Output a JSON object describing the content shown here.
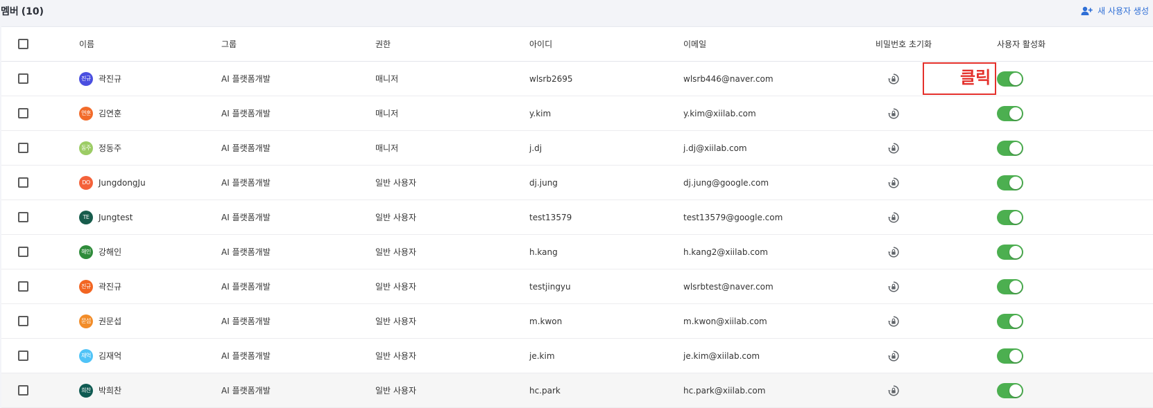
{
  "header": {
    "title": "멤버",
    "count": "(10)",
    "new_user_label": "새 사용자 생성",
    "accent_color": "#2f6fd6"
  },
  "table": {
    "columns": [
      "이름",
      "그룹",
      "권한",
      "아이디",
      "이메일",
      "비밀번호 초기화",
      "사용자 활성화"
    ],
    "rows": [
      {
        "avatar": "진규",
        "avatar_color": "#4a4fe0",
        "name": "곽진규",
        "group": "AI 플랫폼개발",
        "role": "매니저",
        "id": "wlsrb2695",
        "email": "wlsrb446@naver.com",
        "active": true
      },
      {
        "avatar": "연훈",
        "avatar_color": "#f26b2a",
        "name": "김연훈",
        "group": "AI 플랫폼개발",
        "role": "매니저",
        "id": "y.kim",
        "email": "y.kim@xiilab.com",
        "active": true
      },
      {
        "avatar": "동주",
        "avatar_color": "#9ccc65",
        "name": "정동주",
        "group": "AI 플랫폼개발",
        "role": "매니저",
        "id": "j.dj",
        "email": "j.dj@xiilab.com",
        "active": true
      },
      {
        "avatar": "DO",
        "avatar_color": "#f4623a",
        "name": "JungdongJu",
        "group": "AI 플랫폼개발",
        "role": "일반 사용자",
        "id": "dj.jung",
        "email": "dj.jung@google.com",
        "active": true
      },
      {
        "avatar": "TE",
        "avatar_color": "#175c4c",
        "name": "Jungtest",
        "group": "AI 플랫폼개발",
        "role": "일반 사용자",
        "id": "test13579",
        "email": "test13579@google.com",
        "active": true
      },
      {
        "avatar": "해인",
        "avatar_color": "#2e8b3a",
        "name": "강해인",
        "group": "AI 플랫폼개발",
        "role": "일반 사용자",
        "id": "h.kang",
        "email": "h.kang2@xiilab.com",
        "active": true
      },
      {
        "avatar": "진규",
        "avatar_color": "#f26522",
        "name": "곽진규",
        "group": "AI 플랫폼개발",
        "role": "일반 사용자",
        "id": "testjingyu",
        "email": "wlsrbtest@naver.com",
        "active": true
      },
      {
        "avatar": "문섭",
        "avatar_color": "#f28c28",
        "name": "권문섭",
        "group": "AI 플랫폼개발",
        "role": "일반 사용자",
        "id": "m.kwon",
        "email": "m.kwon@xiilab.com",
        "active": true
      },
      {
        "avatar": "재억",
        "avatar_color": "#4fc3f7",
        "name": "김재억",
        "group": "AI 플랫폼개발",
        "role": "일반 사용자",
        "id": "je.kim",
        "email": "je.kim@xiilab.com",
        "active": true
      },
      {
        "avatar": "희찬",
        "avatar_color": "#0f5a52",
        "name": "박희찬",
        "group": "AI 플랫폼개발",
        "role": "일반 사용자",
        "id": "hc.park",
        "email": "hc.park@xiilab.com",
        "active": true
      }
    ]
  },
  "annotation": {
    "label": "클릭",
    "color": "#e4302b"
  },
  "icons": {
    "reset_password": "lock-reset-icon",
    "new_user": "person-add-icon",
    "toggle_on_color": "#4caf50"
  }
}
